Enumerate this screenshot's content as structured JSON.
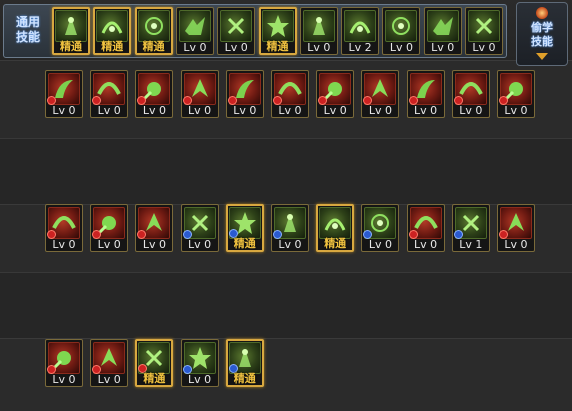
{
  "header": {
    "label": "通用\n技能"
  },
  "right_tab": {
    "label": "偷学\n技能",
    "icon": "flame-gem-icon",
    "arrow_icon": "dropdown-arrow-icon"
  },
  "colors": {
    "mastered_text": "#f0c240",
    "level_text": "#e8e8e8",
    "gold_border": "#d8a840"
  },
  "common_skills": [
    {
      "icon": "crouch-figure-icon",
      "level": "精通",
      "mastered": true,
      "tone": "green"
    },
    {
      "icon": "kneel-figure-icon",
      "level": "精通",
      "mastered": true,
      "tone": "green"
    },
    {
      "icon": "dash-figure-icon",
      "level": "精通",
      "mastered": true,
      "tone": "green"
    },
    {
      "icon": "wings-icon",
      "level": "Lv 0",
      "mastered": false,
      "tone": "green"
    },
    {
      "icon": "crosshair-icon",
      "level": "Lv 0",
      "mastered": false,
      "tone": "green"
    },
    {
      "icon": "target-star-icon",
      "level": "精通",
      "mastered": true,
      "tone": "green"
    },
    {
      "icon": "mushroom-icon",
      "level": "Lv 0",
      "mastered": false,
      "tone": "green"
    },
    {
      "icon": "walker-icon",
      "level": "Lv 2",
      "mastered": false,
      "tone": "green"
    },
    {
      "icon": "spiral-eye-icon",
      "level": "Lv 0",
      "mastered": false,
      "tone": "green"
    },
    {
      "icon": "strongman-icon",
      "level": "Lv 0",
      "mastered": false,
      "tone": "green"
    },
    {
      "icon": "leap-figure-icon",
      "level": "Lv 0",
      "mastered": false,
      "tone": "green"
    }
  ],
  "rows": [
    [
      {
        "icon": "claw-strike-icon",
        "level": "Lv 0",
        "mastered": false,
        "tone": "red",
        "badge": "red"
      },
      {
        "icon": "crescent-slash-icon",
        "level": "Lv 0",
        "mastered": false,
        "tone": "red",
        "badge": "red"
      },
      {
        "icon": "swirl-punch-icon",
        "level": "Lv 0",
        "mastered": false,
        "tone": "red",
        "badge": "red"
      },
      {
        "icon": "beast-icon",
        "level": "Lv 0",
        "mastered": false,
        "tone": "red",
        "badge": "red"
      },
      {
        "icon": "dagger-icon",
        "level": "Lv 0",
        "mastered": false,
        "tone": "red",
        "badge": "red"
      },
      {
        "icon": "dragon-coil-icon",
        "level": "Lv 0",
        "mastered": false,
        "tone": "red",
        "badge": "red"
      },
      {
        "icon": "sword-drop-icon",
        "level": "Lv 0",
        "mastered": false,
        "tone": "red",
        "badge": "red"
      },
      {
        "icon": "spin-kick-icon",
        "level": "Lv 0",
        "mastered": false,
        "tone": "red",
        "badge": "red"
      },
      {
        "icon": "flying-kick-icon",
        "level": "Lv 0",
        "mastered": false,
        "tone": "red",
        "badge": "red"
      },
      {
        "icon": "roll-icon",
        "level": "Lv 0",
        "mastered": false,
        "tone": "red",
        "badge": "red"
      },
      {
        "icon": "grab-icon",
        "level": "Lv 0",
        "mastered": false,
        "tone": "red",
        "badge": "red"
      }
    ],
    [
      {
        "icon": "shield-burst-icon",
        "level": "Lv 0",
        "mastered": false,
        "tone": "red",
        "badge": "red"
      },
      {
        "icon": "arc-slash-icon",
        "level": "Lv 0",
        "mastered": false,
        "tone": "red",
        "badge": "red"
      },
      {
        "icon": "upward-slash-icon",
        "level": "Lv 0",
        "mastered": false,
        "tone": "red",
        "badge": "red"
      },
      {
        "icon": "runner-icon",
        "level": "Lv 0",
        "mastered": false,
        "tone": "green",
        "badge": "ex"
      },
      {
        "icon": "lightning-web-icon",
        "level": "精通",
        "mastered": true,
        "tone": "green",
        "badge": "ex"
      },
      {
        "icon": "wave-arm-icon",
        "level": "Lv 0",
        "mastered": false,
        "tone": "green",
        "badge": "ex"
      },
      {
        "icon": "demon-face-icon",
        "level": "精通",
        "mastered": true,
        "tone": "green",
        "badge": "none"
      },
      {
        "icon": "tri-blade-icon",
        "level": "Lv 0",
        "mastered": false,
        "tone": "green",
        "badge": "ex"
      },
      {
        "icon": "roaring-beast-icon",
        "level": "Lv 0",
        "mastered": false,
        "tone": "red",
        "badge": "red"
      },
      {
        "icon": "wing-strike-icon",
        "level": "Lv 1",
        "mastered": false,
        "tone": "green",
        "badge": "ex"
      },
      {
        "icon": "spider-icon",
        "level": "Lv 0",
        "mastered": false,
        "tone": "red",
        "badge": "red"
      }
    ],
    [
      {
        "icon": "fist-smash-icon",
        "level": "Lv 0",
        "mastered": false,
        "tone": "red",
        "badge": "red"
      },
      {
        "icon": "crab-claw-icon",
        "level": "Lv 0",
        "mastered": false,
        "tone": "red",
        "badge": "red"
      },
      {
        "icon": "swift-dash-icon",
        "level": "精通",
        "mastered": true,
        "tone": "green",
        "badge": "red"
      },
      {
        "icon": "serpent-icon",
        "level": "Lv 0",
        "mastered": false,
        "tone": "green",
        "badge": "ex"
      },
      {
        "icon": "phantom-icon",
        "level": "精通",
        "mastered": true,
        "tone": "green",
        "badge": "ex"
      }
    ]
  ]
}
